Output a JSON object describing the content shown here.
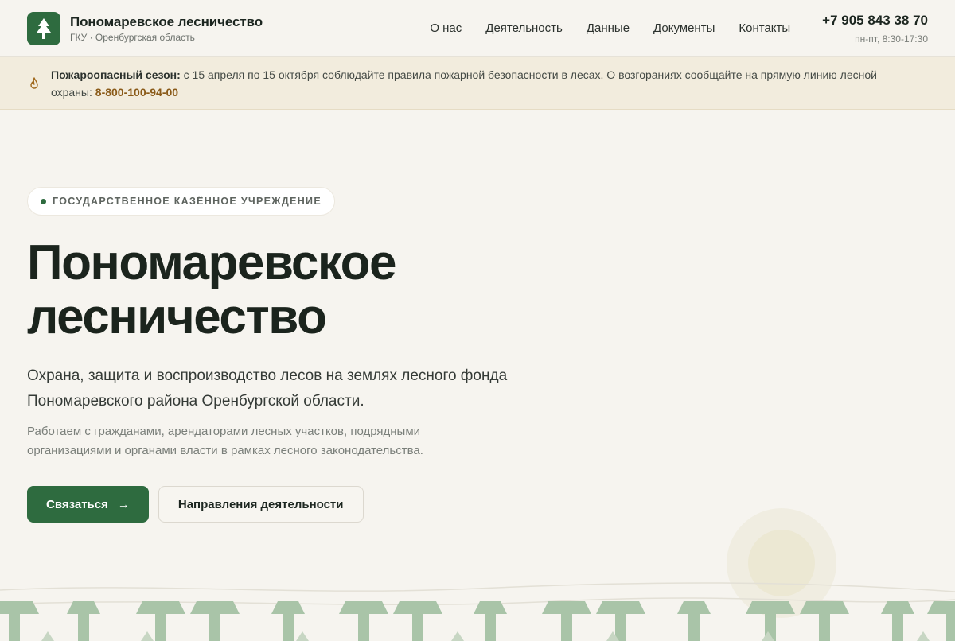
{
  "header": {
    "brand_title": "Пономаревское лесничество",
    "brand_sub": "ГКУ · Оренбургская область",
    "logo_icon": "tree-icon",
    "nav": [
      {
        "label": "О нас"
      },
      {
        "label": "Деятельность"
      },
      {
        "label": "Данные"
      },
      {
        "label": "Документы"
      },
      {
        "label": "Контакты"
      }
    ],
    "phone": "+7 905 843 38 70",
    "hours": "пн-пт, 8:30-17:30"
  },
  "banner": {
    "icon": "fire-icon",
    "lead": "Пожароопасный сезон:",
    "text": " с 15 апреля по 15 октября соблюдайте правила пожарной безопасности в лесах. О возгораниях сообщайте на прямую линию лесной охраны: ",
    "hotline": "8-800-100-94-00"
  },
  "hero": {
    "badge": "ГОСУДАРСТВЕННОЕ КАЗЁННОЕ УЧРЕЖДЕНИЕ",
    "title_line1": "Пономаревское",
    "title_line2": "лесничество",
    "lead": "Охрана, защита и воспроизводство лесов на землях лесного фонда Пономаревского района Оренбургской области.",
    "desc": "Работаем с гражданами, арендаторами лесных участков, подрядными организациями и органами власти в рамках лесного законодательства.",
    "primary_button": "Связаться",
    "primary_icon": "arrow-right-icon",
    "secondary_button": "Направления деятельности"
  },
  "colors": {
    "accent": "#2e6b3f",
    "background": "#f6f4ef",
    "banner_bg": "#f2ecdd",
    "hotline": "#8a5a18",
    "trees": "#a9c4a8"
  }
}
